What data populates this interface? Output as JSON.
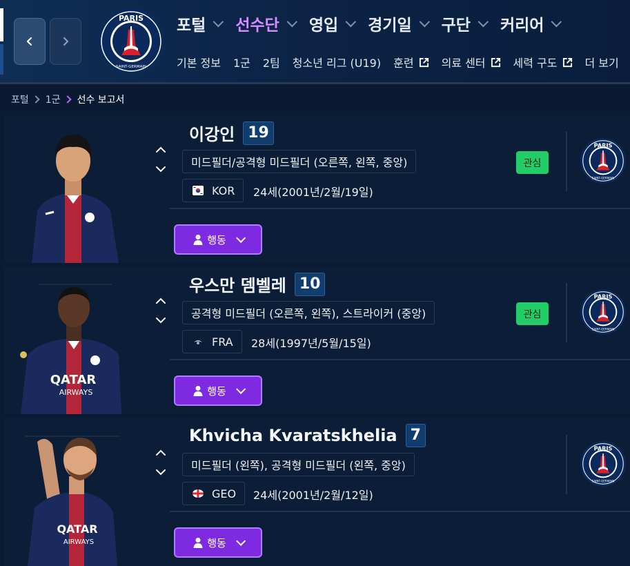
{
  "header": {
    "menu": [
      {
        "label": "포털",
        "active": false
      },
      {
        "label": "선수단",
        "active": true
      },
      {
        "label": "영입",
        "active": false
      },
      {
        "label": "경기일",
        "active": false
      },
      {
        "label": "구단",
        "active": false
      },
      {
        "label": "커리어",
        "active": false
      }
    ],
    "submenu": [
      {
        "label": "기본 정보",
        "external": false
      },
      {
        "label": "1군",
        "external": false
      },
      {
        "label": "2팀",
        "external": false
      },
      {
        "label": "청소년 리그 (U19)",
        "external": false
      },
      {
        "label": "훈련",
        "external": true
      },
      {
        "label": "의료 센터",
        "external": true
      },
      {
        "label": "세력 구도",
        "external": true
      },
      {
        "label": "더 보기",
        "external": false
      }
    ]
  },
  "breadcrumb": [
    "포털",
    "1군",
    "선수 보고서"
  ],
  "players": [
    {
      "name": "이강인",
      "number": "19",
      "position": "미드필더/공격형 미드필더 (오른쪽, 왼쪽, 중앙)",
      "nation": "KOR",
      "age": "24세(2001년/2월/19일)",
      "tag": "관심",
      "action": "행동"
    },
    {
      "name": "우스만 뎀벨레",
      "number": "10",
      "position": "공격형 미드필더 (오른쪽, 왼쪽), 스트라이커 (중앙)",
      "nation": "FRA",
      "age": "28세(1997년/5월/15일)",
      "tag": "관심",
      "action": "행동"
    },
    {
      "name": "Khvicha Kvaratskhelia",
      "number": "7",
      "position": "미드필더 (왼쪽), 공격형 미드필더 (왼쪽, 중앙)",
      "nation": "GEO",
      "age": "24세(2001년/2월/12일)",
      "tag": "",
      "action": "행동"
    }
  ],
  "crest": {
    "top_text": "PARIS",
    "bottom_text": "SAINT-GERMAIN"
  },
  "colors": {
    "active_menu": "#d78cff",
    "action_button": "#7e2ae0",
    "watch_badge": "#22cc66",
    "background": "#0b1a33"
  }
}
